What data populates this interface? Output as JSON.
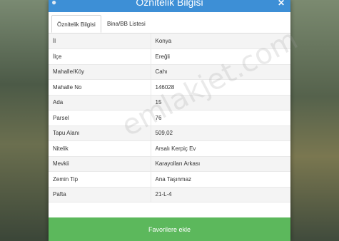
{
  "header": {
    "title": "Öznitelik Bilgisi",
    "icon": "info-icon",
    "close_icon": "close-icon",
    "close_glyph": "✕",
    "accent_color": "#3d8fd6"
  },
  "tabs": [
    {
      "label": "Öznitelik Bilgisi",
      "active": true
    },
    {
      "label": "Bina/BB Listesi",
      "active": false
    }
  ],
  "attributes": [
    {
      "label": "İl",
      "value": "Konya"
    },
    {
      "label": "İlçe",
      "value": "Ereğli"
    },
    {
      "label": "Mahalle/Köy",
      "value": "Cahı"
    },
    {
      "label": "Mahalle No",
      "value": "146028"
    },
    {
      "label": "Ada",
      "value": "15"
    },
    {
      "label": "Parsel",
      "value": "76"
    },
    {
      "label": "Tapu Alanı",
      "value": "509,02"
    },
    {
      "label": "Nitelik",
      "value": "Arsalı Kerpiç Ev"
    },
    {
      "label": "Mevkii",
      "value": "Karayolları Arkası"
    },
    {
      "label": "Zemin Tip",
      "value": "Ana Taşınmaz"
    },
    {
      "label": "Pafta",
      "value": "21-L-4"
    }
  ],
  "watermark": "emlakjet.com",
  "footer": {
    "button_label": "Favorilere ekle",
    "button_color": "#5cb85c"
  }
}
